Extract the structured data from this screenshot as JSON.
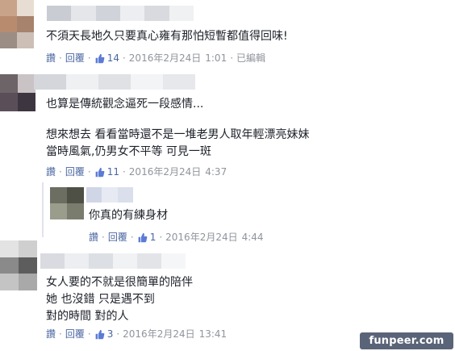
{
  "comments": [
    {
      "lines": [
        "不須天長地久只要真心雍有那怕短暫都值得回味!"
      ],
      "meta": {
        "reply_label": "讚",
        "reply2_label": "回覆",
        "likes": "14",
        "date": "2016年2月24日",
        "time": "1:01",
        "edited": "已編輯"
      }
    },
    {
      "lines": [
        "也算是傳統觀念逼死一段感情...",
        "",
        "想來想去 看看當時還不是一堆老男人取年輕漂亮妹妹",
        "當時風氣,仍男女不平等 可見一斑"
      ],
      "meta": {
        "reply_label": "讚",
        "reply2_label": "回覆",
        "likes": "11",
        "date": "2016年2月24日",
        "time": "4:37"
      }
    },
    {
      "lines": [
        "你真的有練身材"
      ],
      "meta": {
        "reply_label": "讚",
        "reply2_label": "回覆",
        "likes": "1",
        "date": "2016年2月24日",
        "time": "4:44"
      }
    },
    {
      "lines": [
        "女人要的不就是很簡單的陪伴",
        "她 也沒錯 只是遇不到",
        "對的時間 對的人"
      ],
      "meta": {
        "reply_label": "讚",
        "reply2_label": "回覆",
        "likes": "3",
        "date": "2016年2月24日",
        "time": "13:41"
      }
    }
  ],
  "watermark": "funpeer.com",
  "colors": {
    "link": "#4b67a1",
    "meta": "#90949c",
    "text": "#1d2129"
  },
  "icons": {
    "like": "thumbs-up-icon"
  }
}
